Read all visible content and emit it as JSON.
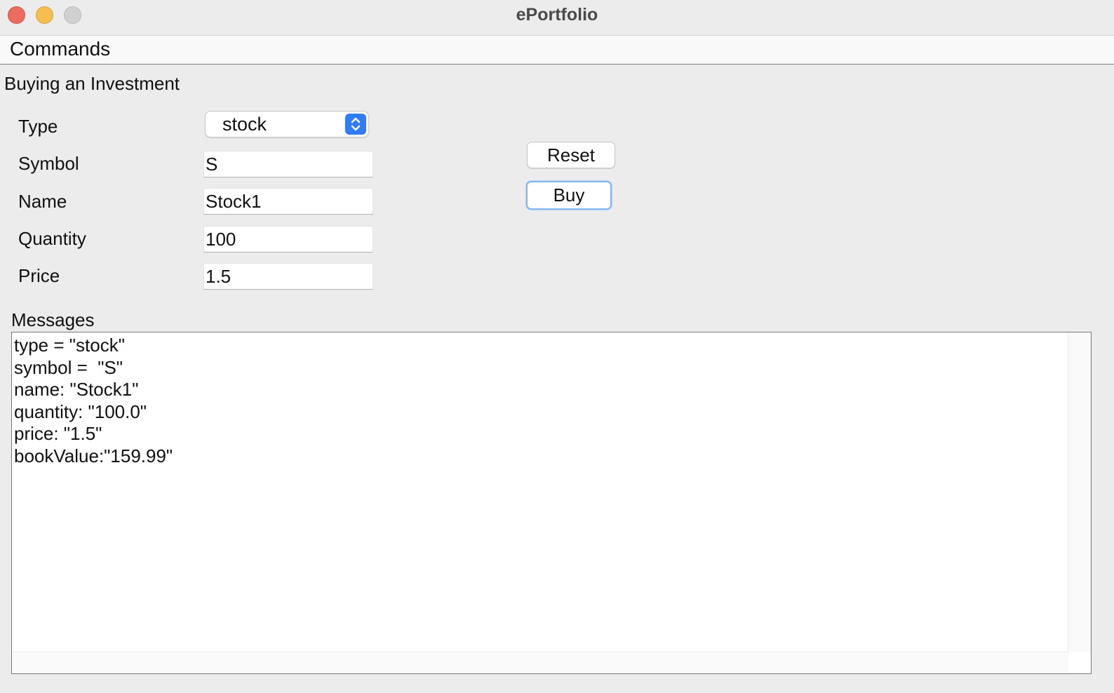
{
  "window": {
    "title": "ePortfolio"
  },
  "menubar": {
    "items": [
      {
        "label": "Commands"
      }
    ]
  },
  "form": {
    "title": "Buying an Investment",
    "fields": {
      "type": {
        "label": "Type",
        "value": "stock"
      },
      "symbol": {
        "label": "Symbol",
        "value": "S"
      },
      "name": {
        "label": "Name",
        "value": "Stock1"
      },
      "quantity": {
        "label": "Quantity",
        "value": "100"
      },
      "price": {
        "label": "Price",
        "value": "1.5"
      }
    },
    "buttons": {
      "reset": "Reset",
      "buy": "Buy"
    }
  },
  "messages": {
    "label": "Messages",
    "text": "type = \"stock\"\nsymbol =  \"S\"\nname: \"Stock1\"\nquantity: \"100.0\"\nprice: \"1.5\"\nbookValue:\"159.99\""
  },
  "colors": {
    "accent": "#2f7cf6",
    "close": "#ed6a5e",
    "minimize": "#f5bf4f",
    "zoom": "#d0d0d0"
  }
}
